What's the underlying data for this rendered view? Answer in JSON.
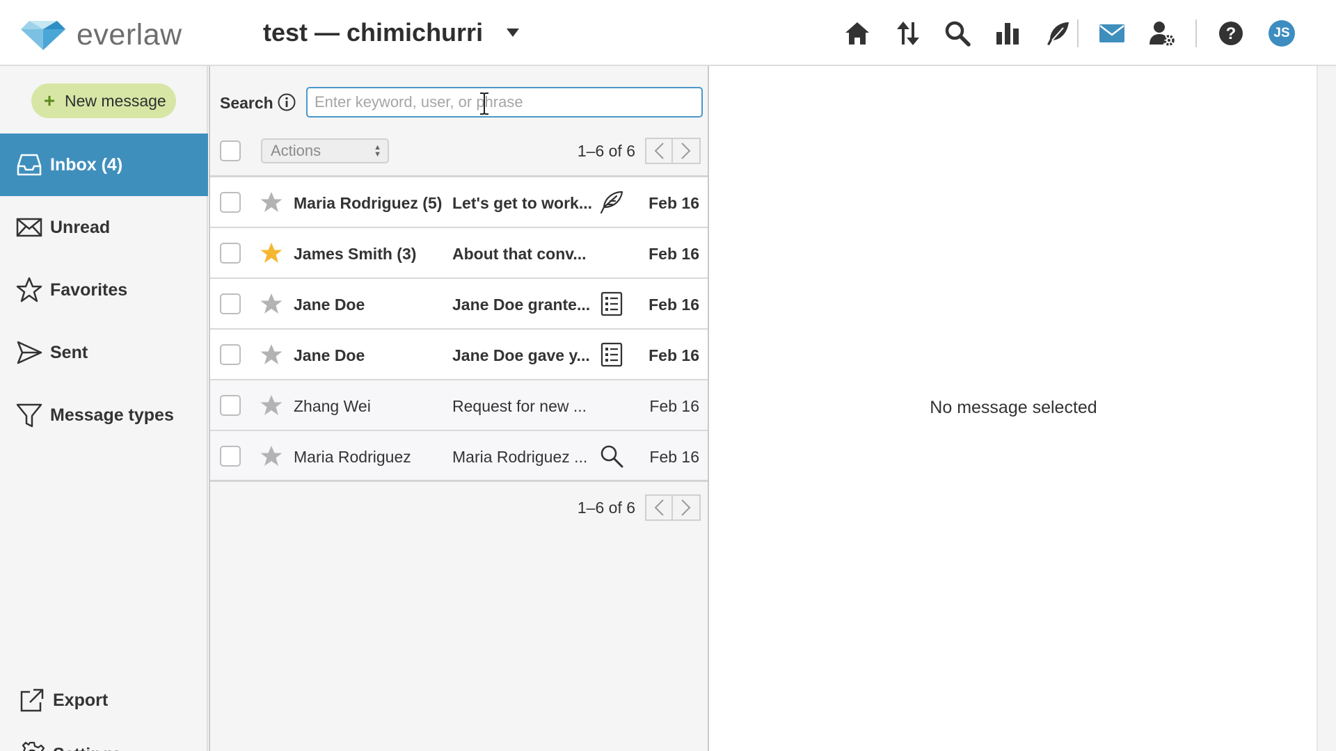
{
  "header": {
    "logo_text": "everlaw",
    "project_title": "test — chimichurri",
    "user_initials": "JS"
  },
  "nav_icons": [
    "home-icon",
    "sort-arrows-icon",
    "search-icon",
    "bar-chart-icon",
    "feather-pen-icon",
    "mail-icon",
    "user-settings-icon",
    "help-icon"
  ],
  "sidebar": {
    "new_message_label": "New message",
    "items": [
      {
        "label": "Inbox (4)",
        "icon": "inbox-icon",
        "active": true
      },
      {
        "label": "Unread",
        "icon": "envelope-icon"
      },
      {
        "label": "Favorites",
        "icon": "star-outline-icon"
      },
      {
        "label": "Sent",
        "icon": "send-icon"
      },
      {
        "label": "Message types",
        "icon": "filter-funnel-icon"
      }
    ],
    "export_label": "Export",
    "settings_label": "Settings"
  },
  "search": {
    "label": "Search",
    "placeholder": "Enter keyword, user, or phrase",
    "value": ""
  },
  "toolbar": {
    "actions_label": "Actions",
    "pager_text": "1–6 of 6"
  },
  "messages": [
    {
      "sender": "Maria Rodriguez (5)",
      "subject": "Let's get to work...",
      "icon": "feather-pen-icon",
      "date": "Feb 16",
      "unread": true,
      "starred": false
    },
    {
      "sender": "James Smith (3)",
      "subject": "About that conv...",
      "icon": "",
      "date": "Feb 16",
      "unread": true,
      "starred": true
    },
    {
      "sender": "Jane Doe",
      "subject": "Jane Doe grante...",
      "icon": "list-document-icon",
      "date": "Feb 16",
      "unread": true,
      "starred": false
    },
    {
      "sender": "Jane Doe",
      "subject": "Jane Doe gave y...",
      "icon": "list-document-icon",
      "date": "Feb 16",
      "unread": true,
      "starred": false
    },
    {
      "sender": "Zhang Wei",
      "subject": "Request for new ...",
      "icon": "",
      "date": "Feb 16",
      "unread": false,
      "starred": false
    },
    {
      "sender": "Maria Rodriguez",
      "subject": "Maria Rodriguez ...",
      "icon": "search-icon",
      "date": "Feb 16",
      "unread": false,
      "starred": false
    }
  ],
  "footer_pager_text": "1–6 of 6",
  "preview": {
    "empty_text": "No message selected"
  },
  "colors": {
    "accent": "#3f8fbd",
    "new_message_bg": "#d7e6a5",
    "star_active": "#f5b731",
    "star_inactive": "#b3b3b3"
  }
}
